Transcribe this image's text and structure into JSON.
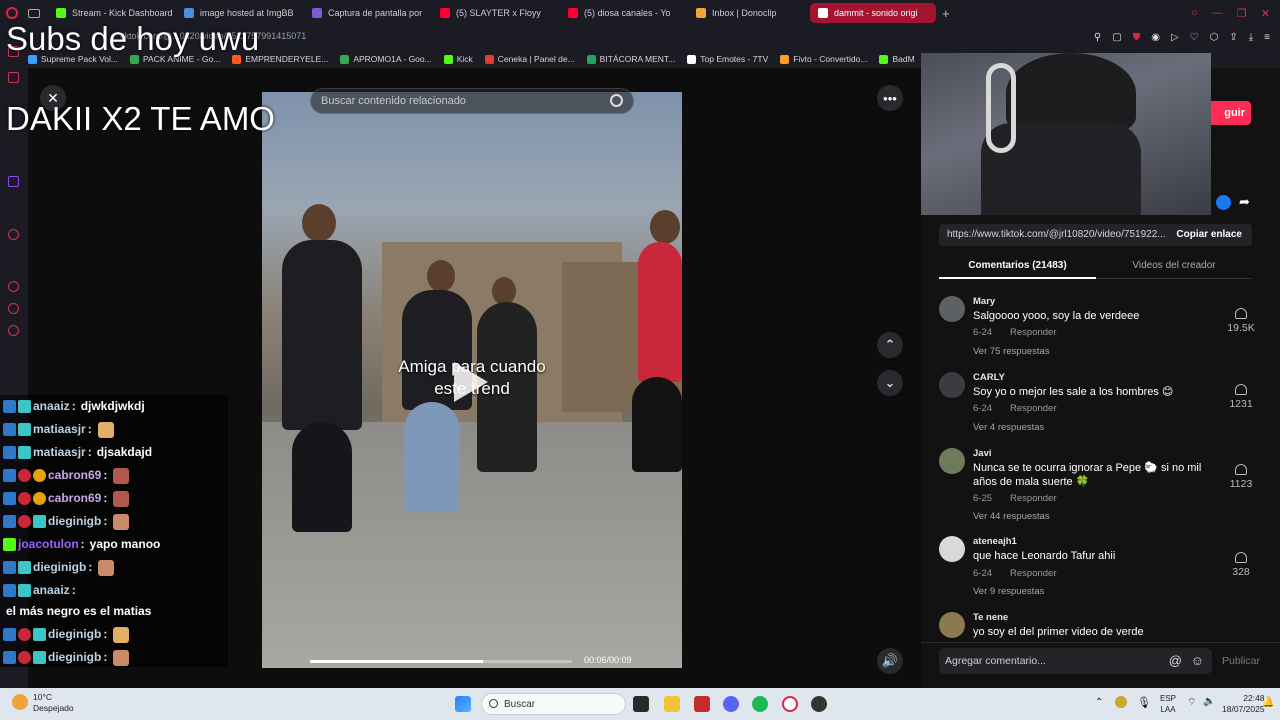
{
  "browser": {
    "tabs": [
      {
        "label": "Stream - Kick Dashboard",
        "color": "#53fc18"
      },
      {
        "label": "image hosted at ImgBB",
        "color": "#4a90d9"
      },
      {
        "label": "Captura de pantalla por",
        "color": "#7b5cd6"
      },
      {
        "label": "(5) SLAYTER x Floyy",
        "color": "#ff0033"
      },
      {
        "label": "(5) diosa canales - Yo",
        "color": "#ff0033"
      },
      {
        "label": "Inbox | Donoclip",
        "color": "#f2a33a"
      },
      {
        "label": "dammit - sonido origi",
        "color": "#ffffff"
      }
    ],
    "url": "tiktok.com/@...0820/video/7513757991415071",
    "bookmarks": [
      {
        "label": "Supreme Pack Vol...",
        "color": "#3aa0ff"
      },
      {
        "label": "PACK ANIME - Go...",
        "color": "#34a853"
      },
      {
        "label": "EMPRENDERYELE...",
        "color": "#ff5a1f"
      },
      {
        "label": "APROMO1A - Goo...",
        "color": "#34a853"
      },
      {
        "label": "Kick",
        "color": "#53fc18"
      },
      {
        "label": "Ceneka | Panel de...",
        "color": "#e53935"
      },
      {
        "label": "BITÁCORA MENT...",
        "color": "#1fa463"
      },
      {
        "label": "Top Emotes - 7TV",
        "color": "#ffffff"
      },
      {
        "label": "Fivto - Convertido...",
        "color": "#ff9c2a"
      },
      {
        "label": "BadM",
        "color": "#53fc18"
      }
    ]
  },
  "overlay": {
    "line1": "Subs de hoy uwu",
    "line2": "DAKII X2 TE AMO"
  },
  "video": {
    "search_placeholder": "Buscar contenido relacionado",
    "caption_line1": "Amiga para cuando",
    "caption_line2": "este trend",
    "timer": "00:06/00:09",
    "progress": 0.66
  },
  "chat": [
    {
      "user": "anaaiz",
      "msg": "djwkdjwkdj",
      "emote": false,
      "color": "#b9d3e6"
    },
    {
      "user": "matiaasjr",
      "msg": "",
      "emote": true,
      "color": "#b9d3e6"
    },
    {
      "user": "matiaasjr",
      "msg": "djsakdajd",
      "emote": false,
      "color": "#b9d3e6"
    },
    {
      "user": "cabron69",
      "msg": "",
      "emote": true,
      "color": "#c9a7e8"
    },
    {
      "user": "cabron69",
      "msg": "",
      "emote": true,
      "color": "#c9a7e8"
    },
    {
      "user": "dieginigb",
      "msg": "",
      "emote": true,
      "color": "#b9d3e6"
    },
    {
      "user": "joacotulon",
      "msg": "yapo manoo",
      "emote": false,
      "color": "#9a62ff"
    },
    {
      "user": "dieginigb",
      "msg": "",
      "emote": true,
      "color": "#b9d3e6"
    },
    {
      "user": "anaaiz",
      "msg": "el más negro es el matias",
      "emote": false,
      "color": "#b9d3e6"
    },
    {
      "user": "dieginigb",
      "msg": "",
      "emote": true,
      "color": "#b9d3e6"
    },
    {
      "user": "dieginigb",
      "msg": "",
      "emote": true,
      "color": "#b9d3e6"
    }
  ],
  "panel": {
    "follow_label": "guir",
    "link": "https://www.tiktok.com/@jrl10820/video/751922...",
    "copy_label": "Copiar enlace",
    "tab_comments": "Comentarios (21483)",
    "tab_videos": "Videos del creador",
    "reply_label": "Responder",
    "comments": [
      {
        "name": "Mary",
        "text": "Salgoooo yooo, soy la de verdeee",
        "date": "6-24",
        "replies": "Ver 75 respuestas",
        "likes": "19.5K"
      },
      {
        "name": "CARLY",
        "text": "Soy yo o mejor les sale a los hombres 😊",
        "date": "6-24",
        "replies": "Ver 4 respuestas",
        "likes": "1231"
      },
      {
        "name": "Javi",
        "text": "Nunca se te ocurra ignorar a Pepe 🐑 si no mil años de mala suerte 🍀",
        "date": "6-25",
        "replies": "Ver 44 respuestas",
        "likes": "1123"
      },
      {
        "name": "ateneajh1",
        "text": "que hace Leonardo Tafur ahii",
        "date": "6-24",
        "replies": "Ver 9 respuestas",
        "likes": "328"
      },
      {
        "name": "Te nene",
        "text": "yo soy el del primer video de verde",
        "date": "",
        "replies": "",
        "likes": ""
      }
    ],
    "add_comment": "Agregar comentario...",
    "publish": "Publicar"
  },
  "taskbar": {
    "weather_temp": "10°C",
    "weather_desc": "Despejado",
    "search": "Buscar",
    "lang1": "ESP",
    "lang2": "LAA",
    "time": "22:48",
    "date": "18/07/2025"
  }
}
